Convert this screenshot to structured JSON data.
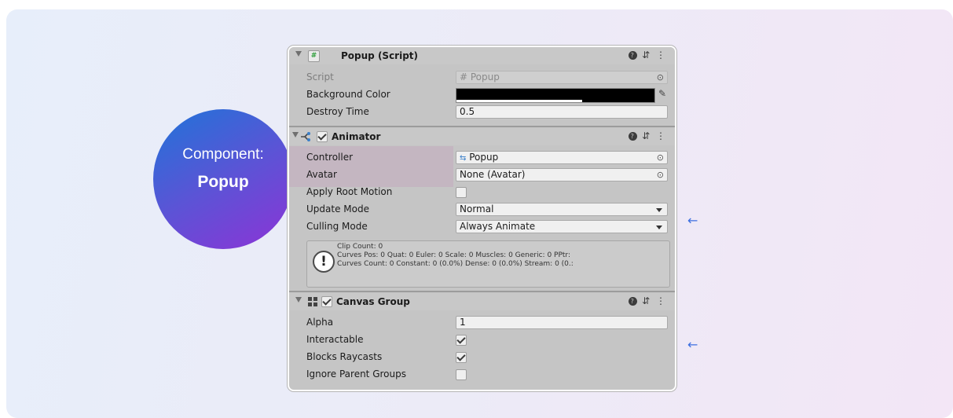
{
  "badge": {
    "line1": "Component:",
    "line2": "Popup"
  },
  "colors": {
    "accent_arrow": "#3d6fe0",
    "badge_start": "#1f74d8",
    "badge_end": "#8d33d6",
    "background_color_value": "#000000"
  },
  "popup_script": {
    "title": "Popup (Script)",
    "icon": "script-hash-icon",
    "rows": {
      "script": {
        "label": "Script",
        "value": "# Popup"
      },
      "background_color": {
        "label": "Background Color"
      },
      "destroy_time": {
        "label": "Destroy Time",
        "value": "0.5"
      }
    }
  },
  "animator": {
    "title": "Animator",
    "enabled": true,
    "rows": {
      "controller": {
        "label": "Controller",
        "value": "Popup"
      },
      "avatar": {
        "label": "Avatar",
        "value": "None (Avatar)"
      },
      "apply_root_motion": {
        "label": "Apply Root Motion",
        "checked": false
      },
      "update_mode": {
        "label": "Update Mode",
        "value": "Normal"
      },
      "culling_mode": {
        "label": "Culling Mode",
        "value": "Always Animate"
      }
    },
    "info": {
      "line1": "Clip Count: 0",
      "line2": "Curves Pos: 0 Quat: 0 Euler: 0 Scale: 0 Muscles: 0 Generic: 0 PPtr:",
      "line3": "Curves Count: 0 Constant: 0 (0.0%) Dense: 0 (0.0%) Stream: 0 (0.:"
    }
  },
  "canvas_group": {
    "title": "Canvas Group",
    "enabled": true,
    "rows": {
      "alpha": {
        "label": "Alpha",
        "value": "1"
      },
      "interactable": {
        "label": "Interactable",
        "checked": true
      },
      "blocks_raycasts": {
        "label": "Blocks Raycasts",
        "checked": true
      },
      "ignore_parent_groups": {
        "label": "Ignore Parent Groups",
        "checked": false
      }
    }
  },
  "header_icons": {
    "help": "?",
    "presets": "⇵",
    "menu": "⋮"
  },
  "arrows": {
    "glyph": "←"
  }
}
